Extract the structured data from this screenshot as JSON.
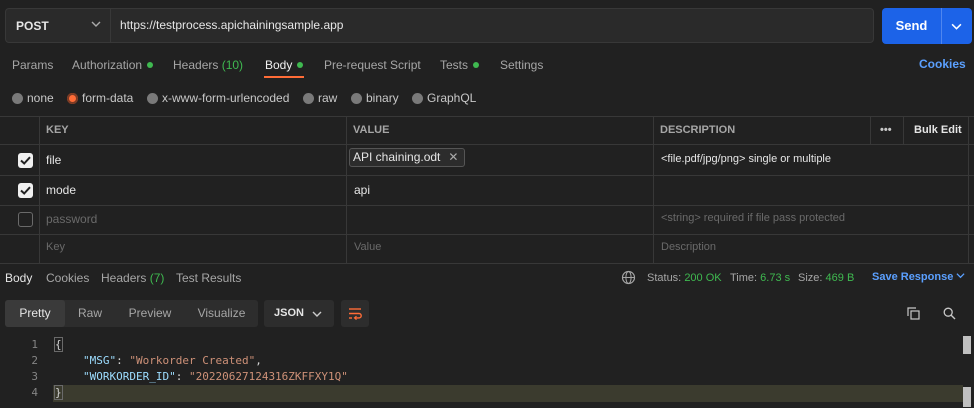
{
  "request": {
    "method": "POST",
    "url": "https://testprocess.apichainingsample.app",
    "send_label": "Send"
  },
  "req_tabs": {
    "params": "Params",
    "authorization": "Authorization",
    "headers": "Headers",
    "headers_count": "(10)",
    "body": "Body",
    "prerequest": "Pre-request Script",
    "tests": "Tests",
    "settings": "Settings",
    "cookies": "Cookies"
  },
  "body_types": [
    "none",
    "form-data",
    "x-www-form-urlencoded",
    "raw",
    "binary",
    "GraphQL"
  ],
  "table": {
    "col_key": "KEY",
    "col_value": "VALUE",
    "col_description": "DESCRIPTION",
    "more": "•••",
    "bulk_edit": "Bulk Edit",
    "rows": [
      {
        "key": "file",
        "value": "API chaining.odt",
        "description": "<file.pdf/jpg/png> single or multiple"
      },
      {
        "key": "mode",
        "value": "api",
        "description": ""
      },
      {
        "key": "password",
        "value": "",
        "description": "<string> required if file pass protected"
      }
    ],
    "placeholder_key": "Key",
    "placeholder_value": "Value",
    "placeholder_description": "Description"
  },
  "response": {
    "tabs": {
      "body": "Body",
      "cookies": "Cookies",
      "headers": "Headers",
      "headers_count": "(7)",
      "test_results": "Test Results"
    },
    "status_label": "Status:",
    "status_value": "200 OK",
    "time_label": "Time:",
    "time_value": "6.73 s",
    "size_label": "Size:",
    "size_value": "469 B",
    "save_response": "Save Response",
    "view_modes": [
      "Pretty",
      "Raw",
      "Preview",
      "Visualize"
    ],
    "format": "JSON",
    "lines": [
      "1",
      "2",
      "3",
      "4"
    ],
    "code": {
      "open": "{",
      "msg_key": "\"MSG\"",
      "msg_value": "\"Workorder Created\"",
      "wo_key": "\"WORKORDER_ID\"",
      "wo_value": "\"20220627124316ZKFFXY1Q\"",
      "close": "}"
    }
  },
  "colors": {
    "accent": "#ff6c37",
    "send": "#1c63e8",
    "success": "#3fb950",
    "link": "#5ba0ff"
  }
}
